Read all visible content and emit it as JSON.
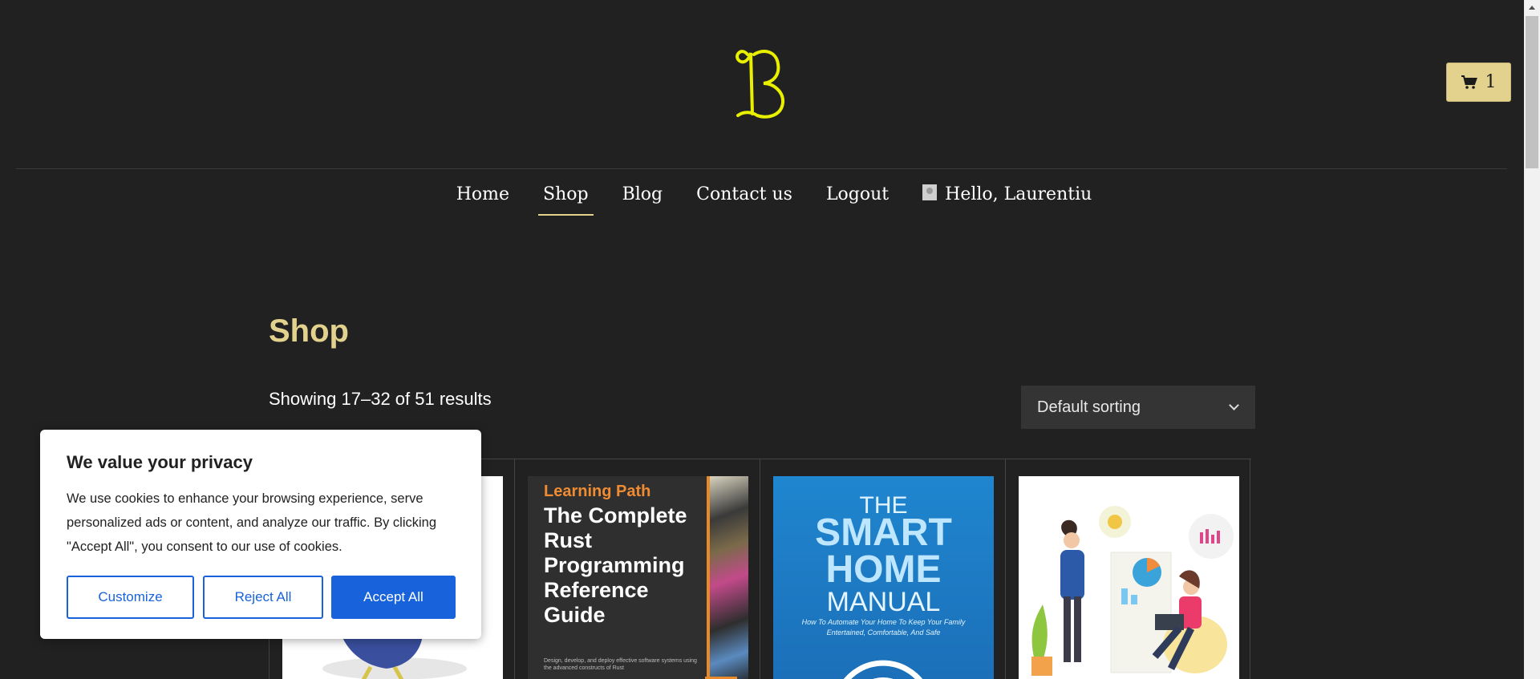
{
  "header": {
    "logo_letter": "B",
    "cart": {
      "icon": "shopping-cart-icon",
      "count": "1"
    }
  },
  "nav": {
    "items": [
      {
        "label": "Home",
        "active": false
      },
      {
        "label": "Shop",
        "active": true
      },
      {
        "label": "Blog",
        "active": false
      },
      {
        "label": "Contact us",
        "active": false
      },
      {
        "label": "Logout",
        "active": false
      }
    ],
    "user_greeting": "Hello, Laurentiu",
    "user_icon": "user-avatar-icon"
  },
  "main": {
    "title": "Shop",
    "results_text": "Showing 17–32 of 51 results",
    "sort": {
      "selected": "Default sorting"
    }
  },
  "products": [
    {
      "cover": "bird-illustration"
    },
    {
      "cover_label": "Learning Path",
      "cover_title": "The Complete Rust Programming Reference Guide",
      "cover_note": "Design, develop, and deploy effective software systems using the advanced constructs of Rust"
    },
    {
      "cover_line1": "THE",
      "cover_line2": "SMART HOME",
      "cover_line3": "MANUAL",
      "cover_note": "How To Automate Your Home To Keep Your Family Entertained, Comfortable, And Safe"
    },
    {
      "cover": "business-illustration"
    }
  ],
  "cookie_banner": {
    "title": "We value your privacy",
    "text": "We use cookies to enhance your browsing experience, serve personalized ads or content, and analyze our traffic. By clicking \"Accept All\", you consent to our use of cookies.",
    "buttons": {
      "customize": "Customize",
      "reject": "Reject All",
      "accept": "Accept All"
    }
  },
  "colors": {
    "background": "#212121",
    "accent": "#e2d28d",
    "logo": "#e8f000",
    "cookie_primary": "#1863dc"
  }
}
